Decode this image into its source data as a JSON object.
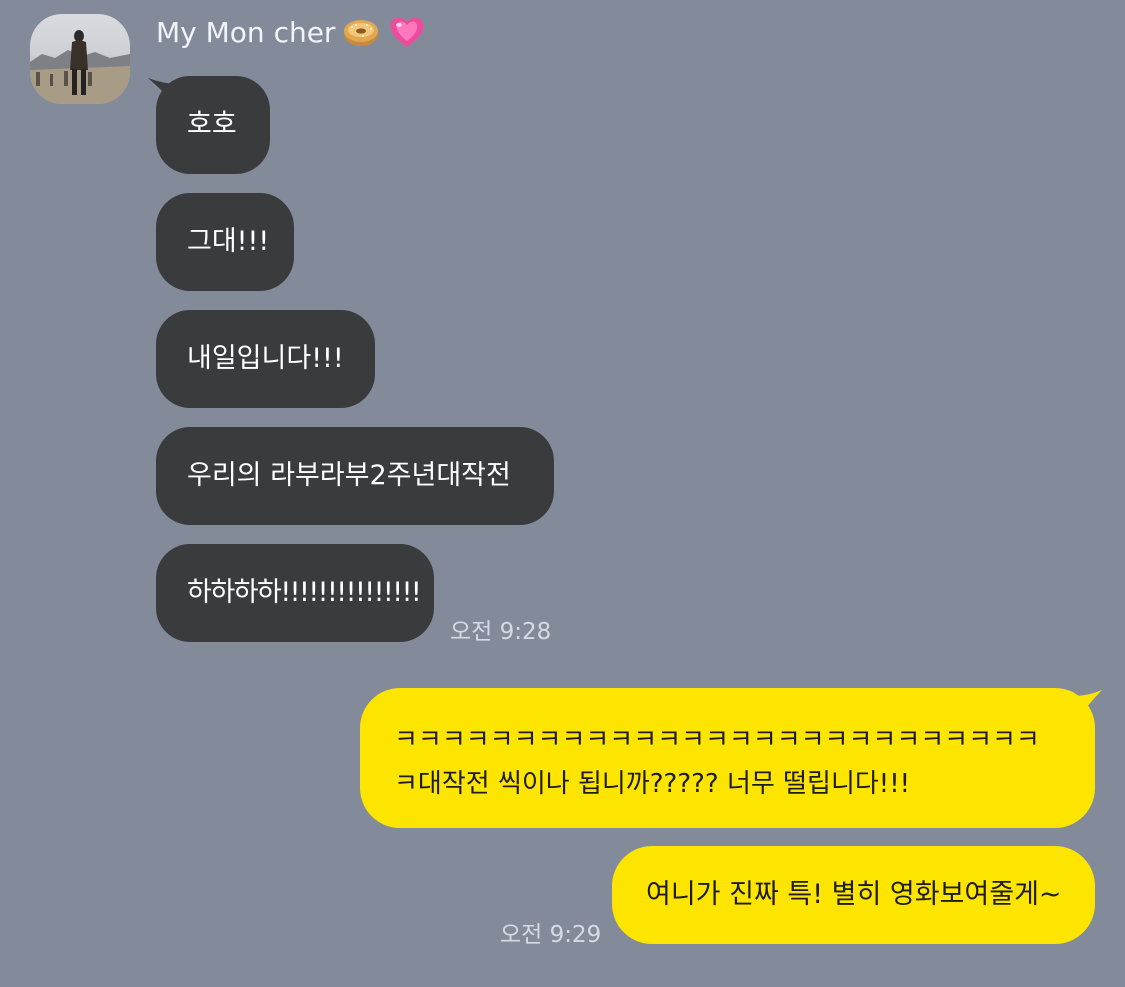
{
  "sender": {
    "name": "My Mon cher",
    "emoji_icons": [
      "bagel-icon",
      "pink-heart-icon"
    ]
  },
  "incoming_messages": [
    {
      "text": "호호"
    },
    {
      "text": "그대!!!"
    },
    {
      "text": "내일입니다!!!"
    },
    {
      "text": "우리의 라부라부2주년대작전"
    },
    {
      "text": "하하하하!!!!!!!!!!!!!!!"
    }
  ],
  "incoming_time": "오전 9:28",
  "outgoing_messages": [
    {
      "text": "ㅋㅋㅋㅋㅋㅋㅋㅋㅋㅋㅋㅋㅋㅋㅋㅋㅋㅋㅋㅋㅋㅋㅋㅋㅋㅋㅋㅋ대작전 씩이나 됩니까????? 너무 떨립니다!!!"
    },
    {
      "text": "여니가 진짜 특! 별히 영화보여줄게~"
    }
  ],
  "outgoing_time": "오전 9:29",
  "colors": {
    "background": "#838b9b",
    "incoming_bubble": "#3a3b3d",
    "outgoing_bubble": "#fee500"
  }
}
